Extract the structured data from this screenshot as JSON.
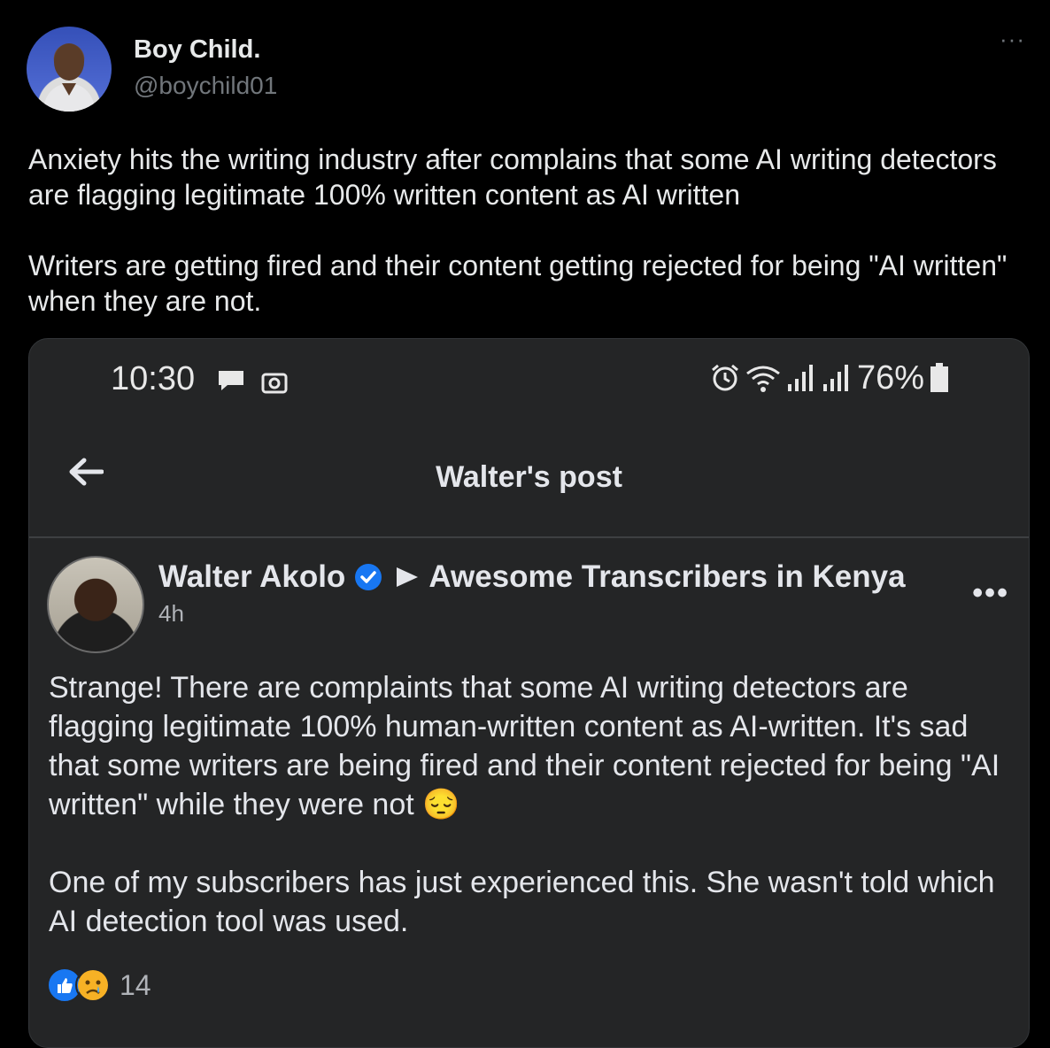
{
  "tweet": {
    "author_name": "Boy Child.",
    "handle": "@boychild01",
    "more": "···",
    "text": "Anxiety hits the writing industry after complains that some AI writing detectors are flagging legitimate 100% written content as AI written\n\nWriters are getting fired and their content getting rejected for being \"AI written\" when they are not."
  },
  "screenshot": {
    "status_bar": {
      "time": "10:30",
      "battery": "76%"
    },
    "nav_title": "Walter's post",
    "post": {
      "author": "Walter Akolo",
      "group": "Awesome Transcribers in Kenya",
      "time": "4h",
      "more": "•••",
      "body": "Strange! There are complaints that some AI writing detectors are flagging legitimate 100% human-written content as AI-written. It's sad that some writers are being fired and their content rejected for being \"AI written\" while they were not 😔\n\nOne of my subscribers has just experienced this. She wasn't told which AI detection tool was used.",
      "reaction_count": "14"
    }
  },
  "colors": {
    "background": "#000000",
    "card": "#242526",
    "accent": "#1877f2"
  },
  "icons": [
    "more-icon",
    "message-icon",
    "camera-icon",
    "alarm-icon",
    "wifi-icon",
    "signal-icon",
    "battery-icon",
    "back-arrow-icon",
    "verified-icon",
    "right-arrow-icon",
    "like-icon",
    "sad-icon"
  ]
}
